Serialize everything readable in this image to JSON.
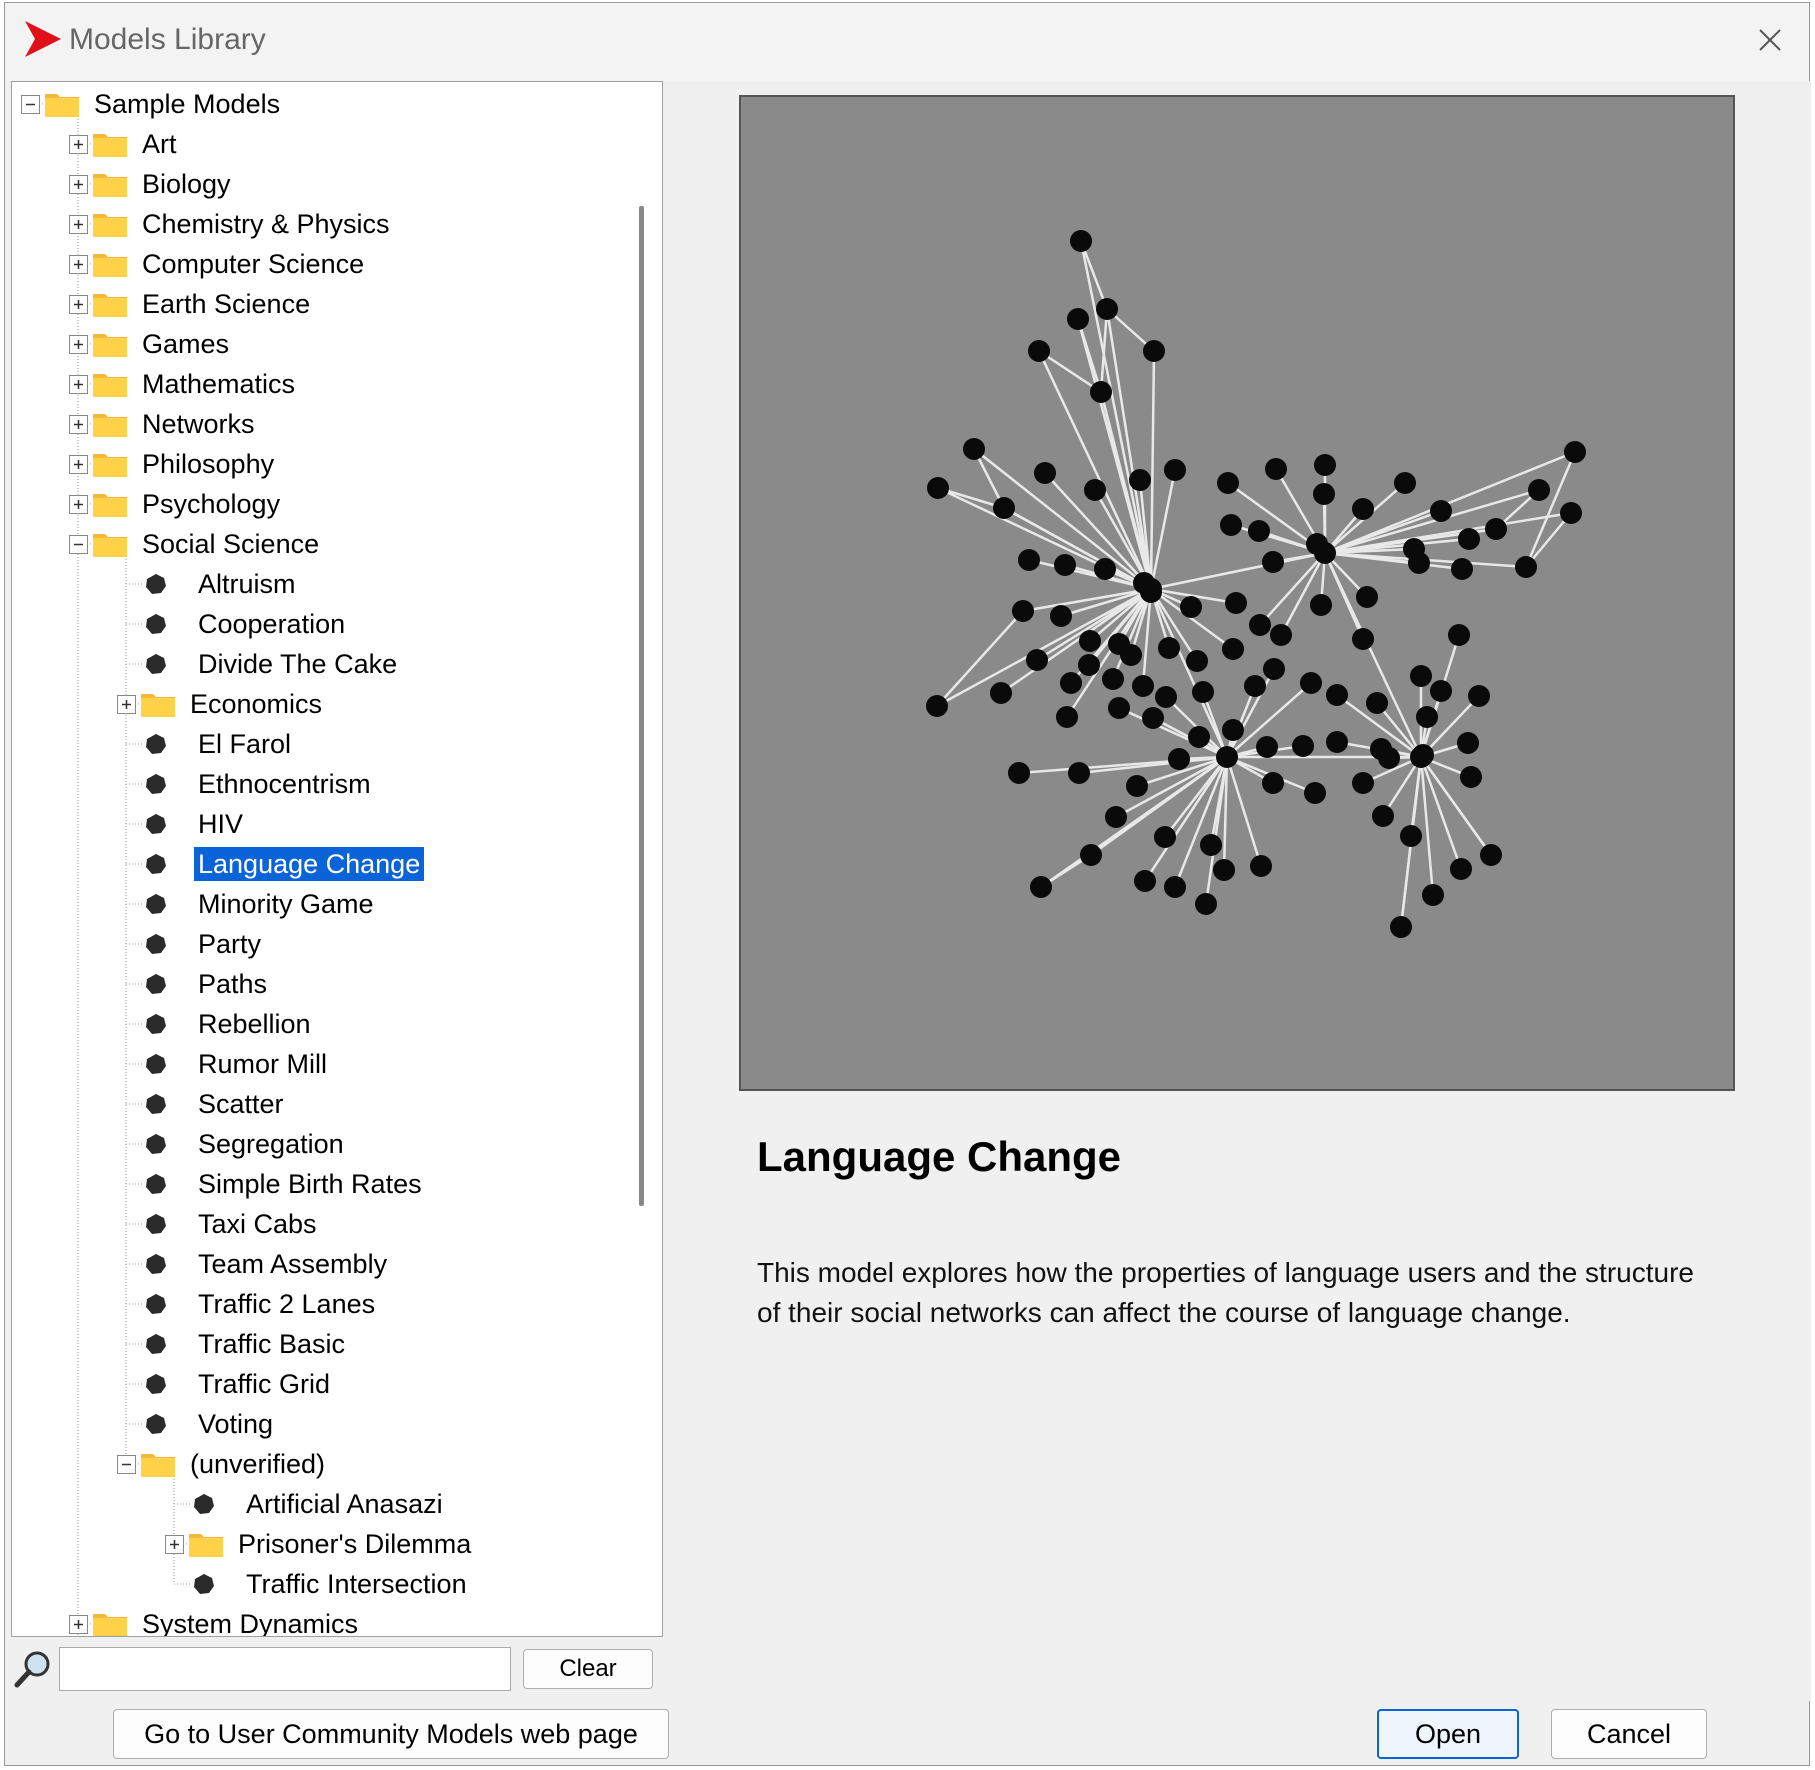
{
  "window": {
    "title": "Models Library"
  },
  "tree": {
    "root": "Sample Models",
    "categories": [
      "Art",
      "Biology",
      "Chemistry & Physics",
      "Computer Science",
      "Earth Science",
      "Games",
      "Mathematics",
      "Networks",
      "Philosophy",
      "Psychology"
    ],
    "social_science": {
      "label": "Social Science",
      "items_before": [
        "Altruism",
        "Cooperation",
        "Divide The Cake"
      ],
      "economics": "Economics",
      "items_after": [
        "El Farol",
        "Ethnocentrism",
        "HIV",
        "Language Change",
        "Minority Game",
        "Party",
        "Paths",
        "Rebellion",
        "Rumor Mill",
        "Scatter",
        "Segregation",
        "Simple Birth Rates",
        "Taxi Cabs",
        "Team Assembly",
        "Traffic 2 Lanes",
        "Traffic Basic",
        "Traffic Grid",
        "Voting"
      ],
      "unverified": {
        "label": "(unverified)",
        "items": [
          "Artificial Anasazi",
          "Prisoner's Dilemma",
          "Traffic Intersection"
        ]
      }
    },
    "after_social": [
      "System Dynamics"
    ],
    "selected": "Language Change"
  },
  "search": {
    "value": "",
    "clear_label": "Clear"
  },
  "model": {
    "title": "Language Change",
    "description": "This model explores how the properties of language users and the structure of their social networks can affect the course of language change."
  },
  "buttons": {
    "community": "Go to User Community Models web page",
    "open": "Open",
    "cancel": "Cancel"
  },
  "colors": {
    "selection": "#0a64d8",
    "folder": "#ffd24a",
    "preview_bg": "#8a8a8a",
    "logo": "#e0101a"
  }
}
